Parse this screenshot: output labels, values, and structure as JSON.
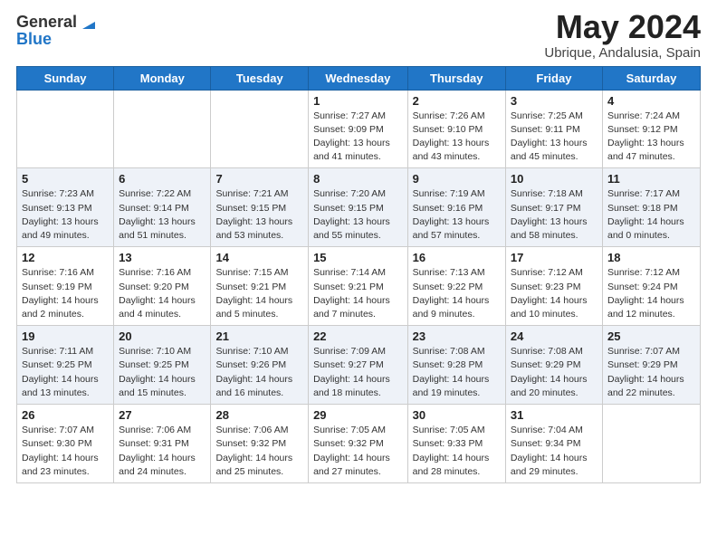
{
  "header": {
    "logo_general": "General",
    "logo_blue": "Blue",
    "title": "May 2024",
    "location": "Ubrique, Andalusia, Spain"
  },
  "weekdays": [
    "Sunday",
    "Monday",
    "Tuesday",
    "Wednesday",
    "Thursday",
    "Friday",
    "Saturday"
  ],
  "weeks": [
    [
      {
        "day": "",
        "sunrise": "",
        "sunset": "",
        "daylight": ""
      },
      {
        "day": "",
        "sunrise": "",
        "sunset": "",
        "daylight": ""
      },
      {
        "day": "",
        "sunrise": "",
        "sunset": "",
        "daylight": ""
      },
      {
        "day": "1",
        "sunrise": "Sunrise: 7:27 AM",
        "sunset": "Sunset: 9:09 PM",
        "daylight": "Daylight: 13 hours and 41 minutes."
      },
      {
        "day": "2",
        "sunrise": "Sunrise: 7:26 AM",
        "sunset": "Sunset: 9:10 PM",
        "daylight": "Daylight: 13 hours and 43 minutes."
      },
      {
        "day": "3",
        "sunrise": "Sunrise: 7:25 AM",
        "sunset": "Sunset: 9:11 PM",
        "daylight": "Daylight: 13 hours and 45 minutes."
      },
      {
        "day": "4",
        "sunrise": "Sunrise: 7:24 AM",
        "sunset": "Sunset: 9:12 PM",
        "daylight": "Daylight: 13 hours and 47 minutes."
      }
    ],
    [
      {
        "day": "5",
        "sunrise": "Sunrise: 7:23 AM",
        "sunset": "Sunset: 9:13 PM",
        "daylight": "Daylight: 13 hours and 49 minutes."
      },
      {
        "day": "6",
        "sunrise": "Sunrise: 7:22 AM",
        "sunset": "Sunset: 9:14 PM",
        "daylight": "Daylight: 13 hours and 51 minutes."
      },
      {
        "day": "7",
        "sunrise": "Sunrise: 7:21 AM",
        "sunset": "Sunset: 9:15 PM",
        "daylight": "Daylight: 13 hours and 53 minutes."
      },
      {
        "day": "8",
        "sunrise": "Sunrise: 7:20 AM",
        "sunset": "Sunset: 9:15 PM",
        "daylight": "Daylight: 13 hours and 55 minutes."
      },
      {
        "day": "9",
        "sunrise": "Sunrise: 7:19 AM",
        "sunset": "Sunset: 9:16 PM",
        "daylight": "Daylight: 13 hours and 57 minutes."
      },
      {
        "day": "10",
        "sunrise": "Sunrise: 7:18 AM",
        "sunset": "Sunset: 9:17 PM",
        "daylight": "Daylight: 13 hours and 58 minutes."
      },
      {
        "day": "11",
        "sunrise": "Sunrise: 7:17 AM",
        "sunset": "Sunset: 9:18 PM",
        "daylight": "Daylight: 14 hours and 0 minutes."
      }
    ],
    [
      {
        "day": "12",
        "sunrise": "Sunrise: 7:16 AM",
        "sunset": "Sunset: 9:19 PM",
        "daylight": "Daylight: 14 hours and 2 minutes."
      },
      {
        "day": "13",
        "sunrise": "Sunrise: 7:16 AM",
        "sunset": "Sunset: 9:20 PM",
        "daylight": "Daylight: 14 hours and 4 minutes."
      },
      {
        "day": "14",
        "sunrise": "Sunrise: 7:15 AM",
        "sunset": "Sunset: 9:21 PM",
        "daylight": "Daylight: 14 hours and 5 minutes."
      },
      {
        "day": "15",
        "sunrise": "Sunrise: 7:14 AM",
        "sunset": "Sunset: 9:21 PM",
        "daylight": "Daylight: 14 hours and 7 minutes."
      },
      {
        "day": "16",
        "sunrise": "Sunrise: 7:13 AM",
        "sunset": "Sunset: 9:22 PM",
        "daylight": "Daylight: 14 hours and 9 minutes."
      },
      {
        "day": "17",
        "sunrise": "Sunrise: 7:12 AM",
        "sunset": "Sunset: 9:23 PM",
        "daylight": "Daylight: 14 hours and 10 minutes."
      },
      {
        "day": "18",
        "sunrise": "Sunrise: 7:12 AM",
        "sunset": "Sunset: 9:24 PM",
        "daylight": "Daylight: 14 hours and 12 minutes."
      }
    ],
    [
      {
        "day": "19",
        "sunrise": "Sunrise: 7:11 AM",
        "sunset": "Sunset: 9:25 PM",
        "daylight": "Daylight: 14 hours and 13 minutes."
      },
      {
        "day": "20",
        "sunrise": "Sunrise: 7:10 AM",
        "sunset": "Sunset: 9:25 PM",
        "daylight": "Daylight: 14 hours and 15 minutes."
      },
      {
        "day": "21",
        "sunrise": "Sunrise: 7:10 AM",
        "sunset": "Sunset: 9:26 PM",
        "daylight": "Daylight: 14 hours and 16 minutes."
      },
      {
        "day": "22",
        "sunrise": "Sunrise: 7:09 AM",
        "sunset": "Sunset: 9:27 PM",
        "daylight": "Daylight: 14 hours and 18 minutes."
      },
      {
        "day": "23",
        "sunrise": "Sunrise: 7:08 AM",
        "sunset": "Sunset: 9:28 PM",
        "daylight": "Daylight: 14 hours and 19 minutes."
      },
      {
        "day": "24",
        "sunrise": "Sunrise: 7:08 AM",
        "sunset": "Sunset: 9:29 PM",
        "daylight": "Daylight: 14 hours and 20 minutes."
      },
      {
        "day": "25",
        "sunrise": "Sunrise: 7:07 AM",
        "sunset": "Sunset: 9:29 PM",
        "daylight": "Daylight: 14 hours and 22 minutes."
      }
    ],
    [
      {
        "day": "26",
        "sunrise": "Sunrise: 7:07 AM",
        "sunset": "Sunset: 9:30 PM",
        "daylight": "Daylight: 14 hours and 23 minutes."
      },
      {
        "day": "27",
        "sunrise": "Sunrise: 7:06 AM",
        "sunset": "Sunset: 9:31 PM",
        "daylight": "Daylight: 14 hours and 24 minutes."
      },
      {
        "day": "28",
        "sunrise": "Sunrise: 7:06 AM",
        "sunset": "Sunset: 9:32 PM",
        "daylight": "Daylight: 14 hours and 25 minutes."
      },
      {
        "day": "29",
        "sunrise": "Sunrise: 7:05 AM",
        "sunset": "Sunset: 9:32 PM",
        "daylight": "Daylight: 14 hours and 27 minutes."
      },
      {
        "day": "30",
        "sunrise": "Sunrise: 7:05 AM",
        "sunset": "Sunset: 9:33 PM",
        "daylight": "Daylight: 14 hours and 28 minutes."
      },
      {
        "day": "31",
        "sunrise": "Sunrise: 7:04 AM",
        "sunset": "Sunset: 9:34 PM",
        "daylight": "Daylight: 14 hours and 29 minutes."
      },
      {
        "day": "",
        "sunrise": "",
        "sunset": "",
        "daylight": ""
      }
    ]
  ]
}
